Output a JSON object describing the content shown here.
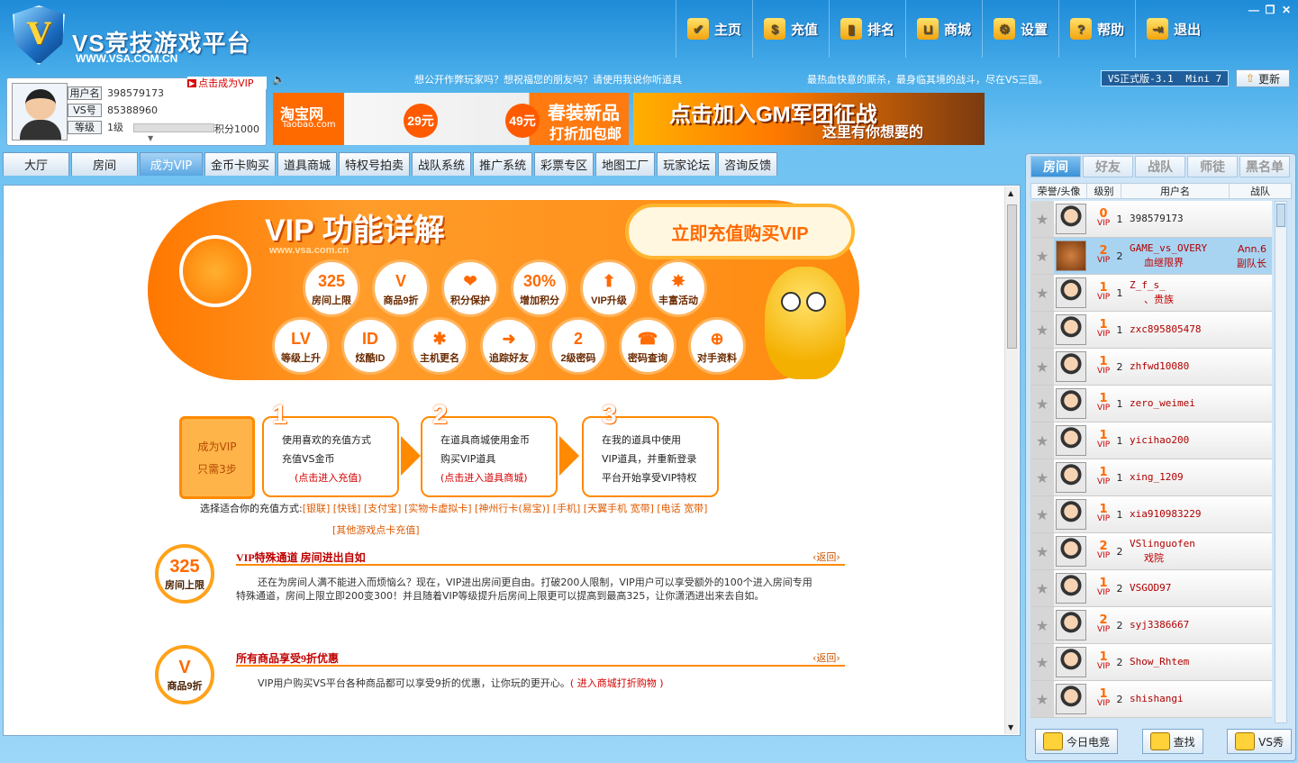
{
  "app": {
    "brand": "VS竞技游戏平台",
    "url": "WWW.VSA.COM.CN"
  },
  "nav": [
    {
      "label": "主页",
      "icon": "shield-icon"
    },
    {
      "label": "充值",
      "icon": "coins-icon"
    },
    {
      "label": "排名",
      "icon": "bar-chart-icon"
    },
    {
      "label": "商城",
      "icon": "cart-icon"
    },
    {
      "label": "设置",
      "icon": "gear-icon"
    },
    {
      "label": "帮助",
      "icon": "help-icon"
    },
    {
      "label": "退出",
      "icon": "exit-icon"
    }
  ],
  "window": {
    "minimize": "—",
    "restore": "❐",
    "close": "✕"
  },
  "ticker": {
    "left": "想公开作弊玩家吗？想祝福您的朋友吗？请使用我说你听道具",
    "right": "最热血快意的厮杀，最身临其境的战斗，尽在VS三国。"
  },
  "version": {
    "label": "VS正式版-3.1",
    "mini": "Mini 7",
    "update": "更新"
  },
  "user": {
    "name_label": "用户名",
    "name": "398579173",
    "vs_label": "VS号",
    "vs": "85388960",
    "level_label": "等级",
    "level": "1级",
    "score": "积分1000",
    "vip_link": "点击成为VIP"
  },
  "banners": {
    "taobao": "淘宝网",
    "taobao_sub": "Taobao.com",
    "price1": "29元",
    "price2": "49元",
    "taobao_promo": "春装新品",
    "taobao_promo2": "打折加包邮",
    "gm": "点击加入GM军团征战",
    "gm_sub": "这里有你想要的"
  },
  "tabs": [
    "大厅",
    "房间",
    "成为VIP",
    "金币卡购买",
    "道具商城",
    "特权号拍卖",
    "战队系统",
    "推广系统",
    "彩票专区",
    "地图工厂",
    "玩家论坛",
    "咨询反馈"
  ],
  "vip": {
    "title": "VIP 功能详解",
    "sub": "www.vsa.com.cn",
    "buy": "立即充值购买VIP",
    "features": [
      {
        "icon": "325",
        "label": "房间上限"
      },
      {
        "icon": "V",
        "label": "商品9折"
      },
      {
        "icon": "❤",
        "label": "积分保护"
      },
      {
        "icon": "30%",
        "label": "增加积分"
      },
      {
        "icon": "⬆",
        "label": "VIP升级"
      },
      {
        "icon": "✸",
        "label": "丰富活动"
      },
      {
        "icon": "LV",
        "label": "等级上升"
      },
      {
        "icon": "ID",
        "label": "炫酷ID"
      },
      {
        "icon": "✱",
        "label": "主机更名"
      },
      {
        "icon": "➜",
        "label": "追踪好友"
      },
      {
        "icon": "2",
        "label": "2级密码"
      },
      {
        "icon": "☎",
        "label": "密码查询"
      },
      {
        "icon": "⊕",
        "label": "对手资料"
      }
    ],
    "step0": [
      "成为VIP",
      "只需3步"
    ],
    "steps": [
      {
        "n": "1",
        "lines": [
          "使用喜欢的充值方式",
          "充值VS金币"
        ],
        "link": "(点击进入充值)"
      },
      {
        "n": "2",
        "lines": [
          "在道具商城使用金币",
          "购买VIP道具"
        ],
        "link": "(点击进入道具商城)"
      },
      {
        "n": "3",
        "lines": [
          "在我的道具中使用",
          "VIP道具，并重新登录",
          "平台开始享受VIP特权"
        ],
        "link": ""
      }
    ],
    "pay_label": "选择适合你的充值方式:",
    "pay_methods": "[银联] [快钱] [支付宝] [实物卡虚拟卡] [神州行卡(易宝)] [手机] [天翼手机 宽带] [电话 宽带]",
    "pay_more": "[其他游戏点卡充值]",
    "sections": [
      {
        "icon": "325",
        "icon_label": "房间上限",
        "title": "VIP特殊通道 房间进出自如",
        "back": "返回",
        "body": "还在为房间人满不能进入而烦恼么？现在，VIP进出房间更自由。打破200人限制，VIP用户可以享受额外的100个进入房间专用特殊通道，房间上限立即200变300！并且随着VIP等级提升后房间上限更可以提高到最高325，让你潇洒进出来去自如。",
        "link": ""
      },
      {
        "icon": "V",
        "icon_label": "商品9折",
        "title": "所有商品享受9折优惠",
        "back": "返回",
        "body": "VIP用户购买VS平台各种商品都可以享受9折的优惠，让你玩的更开心。",
        "link": "( 进入商城打折购物 )"
      }
    ]
  },
  "right": {
    "tabs": [
      "房间",
      "好友",
      "战队",
      "师徒",
      "黑名单"
    ],
    "headers": [
      "荣誉/头像",
      "级别",
      "用户名",
      "战队"
    ],
    "users": [
      {
        "vip": "0",
        "lv": "1",
        "name": "398579173",
        "tag": "",
        "team": ""
      },
      {
        "vip": "2",
        "lv": "2",
        "name": "GAME_vs_OVERY",
        "tag": "血继限界",
        "team": "Ann.6",
        "team2": "副队长"
      },
      {
        "vip": "1",
        "lv": "1",
        "name": "Z_f_s_",
        "tag": "、贵族",
        "team": ""
      },
      {
        "vip": "1",
        "lv": "1",
        "name": "zxc895805478",
        "tag": "",
        "team": ""
      },
      {
        "vip": "1",
        "lv": "2",
        "name": "zhfwd10080",
        "tag": "",
        "team": ""
      },
      {
        "vip": "1",
        "lv": "1",
        "name": "zero_weimei",
        "tag": "",
        "team": ""
      },
      {
        "vip": "1",
        "lv": "1",
        "name": "yicihao200",
        "tag": "",
        "team": ""
      },
      {
        "vip": "1",
        "lv": "1",
        "name": "xing_1209",
        "tag": "",
        "team": ""
      },
      {
        "vip": "1",
        "lv": "1",
        "name": "xia910983229",
        "tag": "",
        "team": ""
      },
      {
        "vip": "2",
        "lv": "2",
        "name": "VSlinguofen",
        "tag": "戏院",
        "team": ""
      },
      {
        "vip": "1",
        "lv": "2",
        "name": "VSGOD97",
        "tag": "",
        "team": ""
      },
      {
        "vip": "2",
        "lv": "2",
        "name": "syj3386667",
        "tag": "",
        "team": ""
      },
      {
        "vip": "1",
        "lv": "2",
        "name": "Show_Rhtem",
        "tag": "",
        "team": ""
      },
      {
        "vip": "1",
        "lv": "2",
        "name": "shishangi",
        "tag": "",
        "team": ""
      }
    ],
    "buttons": [
      {
        "label": "今日电竞",
        "icon": "news-icon"
      },
      {
        "label": "查找",
        "icon": "search-icon"
      },
      {
        "label": "VS秀",
        "icon": "shirt-icon"
      }
    ]
  },
  "colors": {
    "accent": "#ff8a00",
    "header": "#1e8bd8",
    "vip_red": "#d60000"
  }
}
